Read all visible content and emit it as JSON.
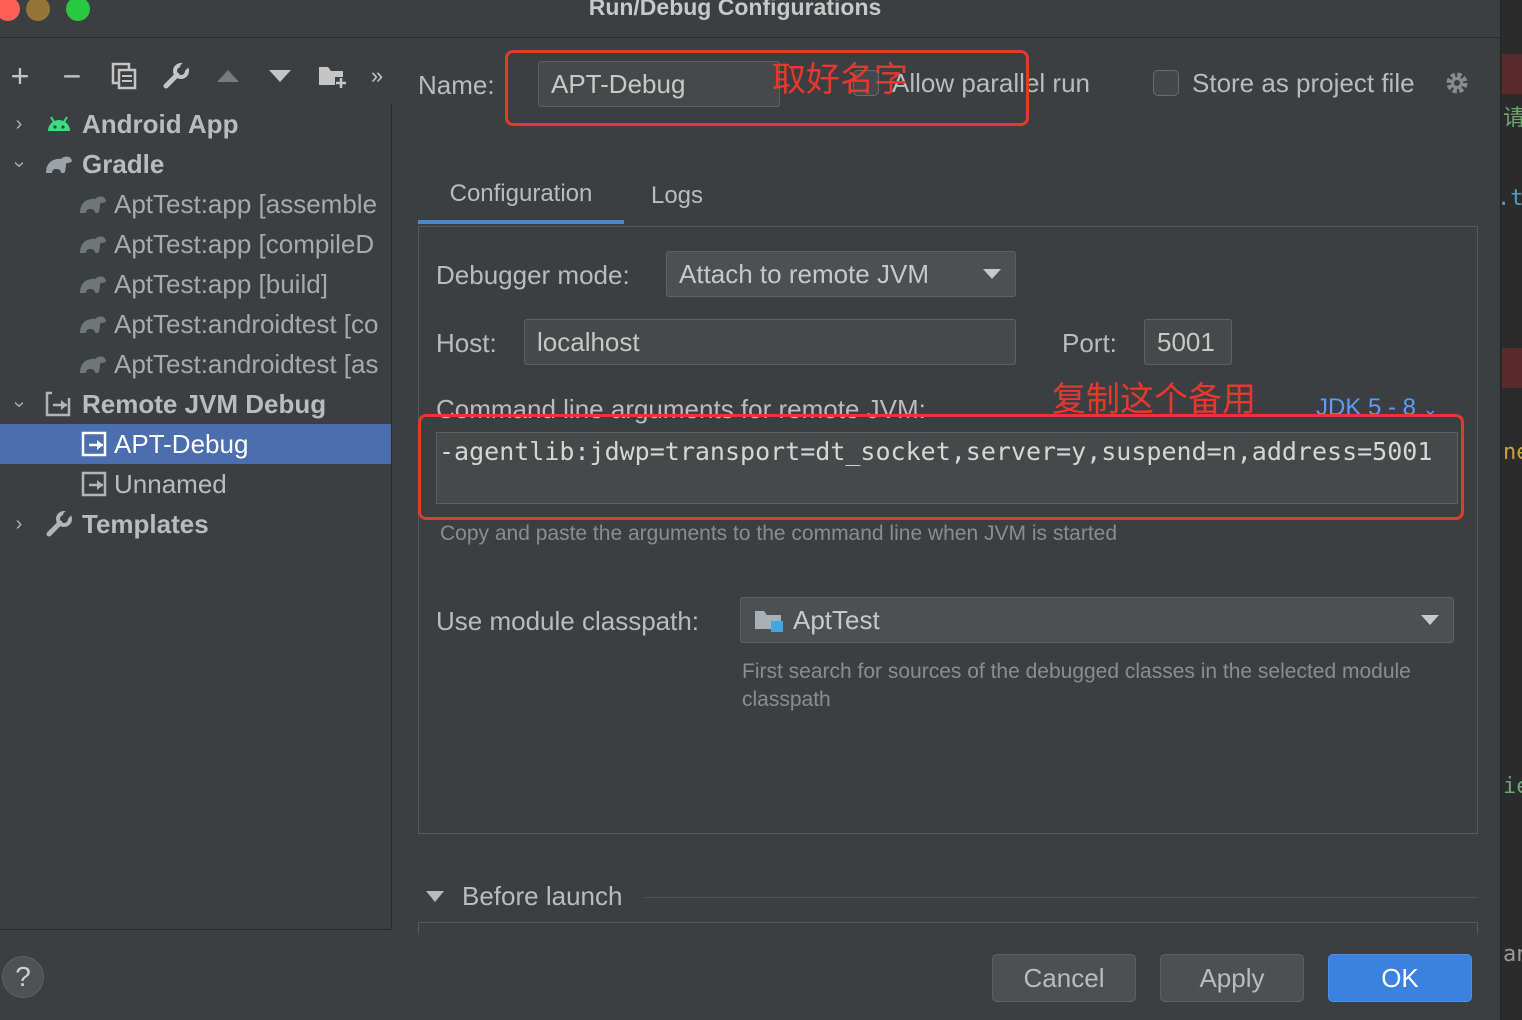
{
  "window": {
    "title": "Run/Debug Configurations"
  },
  "toolbar": {
    "add_icon": "+",
    "remove_icon": "−",
    "copy_icon": "copy-icon",
    "edit_icon": "wrench-icon",
    "up_icon": "arrow-up-icon",
    "down_icon": "arrow-down-icon",
    "folder_icon": "folder-add-icon",
    "more_icon": "»"
  },
  "tree": {
    "items": [
      {
        "label": "Android App"
      },
      {
        "label": "Gradle"
      },
      {
        "label": "AptTest:app [assemble"
      },
      {
        "label": "AptTest:app [compileD"
      },
      {
        "label": "AptTest:app [build]"
      },
      {
        "label": "AptTest:androidtest [co"
      },
      {
        "label": "AptTest:androidtest [as"
      },
      {
        "label": "Remote JVM Debug"
      },
      {
        "label": "APT-Debug"
      },
      {
        "label": "Unnamed"
      },
      {
        "label": "Templates"
      }
    ]
  },
  "form": {
    "name_label": "Name:",
    "name_value": "APT-Debug",
    "allow_parallel_label": "Allow parallel run",
    "store_label": "Store as project file"
  },
  "tabs": [
    {
      "label": "Configuration"
    },
    {
      "label": "Logs"
    }
  ],
  "config": {
    "debugger_mode_label": "Debugger mode:",
    "debugger_mode_value": "Attach to remote JVM",
    "host_label": "Host:",
    "host_value": "localhost",
    "port_label": "Port:",
    "port_value": "5001",
    "cmd_label": "Command line arguments for remote JVM:",
    "jdk_value": "JDK 5 - 8",
    "cmd_value": "-agentlib:jdwp=transport=dt_socket,server=y,suspend=n,address=5001",
    "cmd_hint": "Copy and paste the arguments to the command line when JVM is started",
    "classpath_label": "Use module classpath:",
    "classpath_value": "AptTest",
    "classpath_hint": "First search for sources of the debugged classes in the selected module classpath"
  },
  "before_launch": {
    "label": "Before launch"
  },
  "buttons": {
    "cancel": "Cancel",
    "apply": "Apply",
    "ok": "OK",
    "help": "?"
  },
  "annotations": {
    "name_note": "取好名字",
    "cmd_note": "复制这个备用"
  },
  "editor_strip": {
    "c1": "请",
    "c2": ".t",
    "c3": "ne",
    "c4": "ie",
    "c5": "an"
  },
  "colors": {
    "accent": "#4b6eaf",
    "primary_button": "#3b82e0",
    "annotation": "#e8382e",
    "link": "#589df6"
  }
}
